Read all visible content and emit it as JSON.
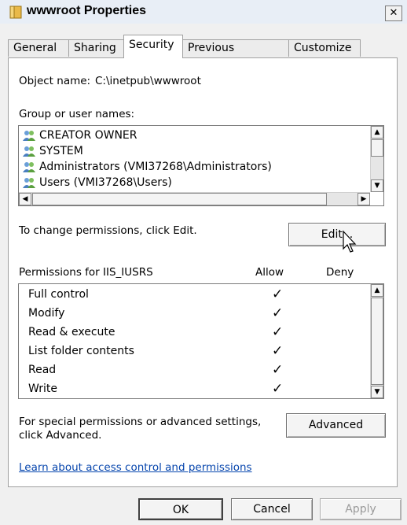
{
  "window": {
    "title": "wwwroot Properties",
    "close_glyph": "✕"
  },
  "tabs": [
    {
      "label": "General"
    },
    {
      "label": "Sharing"
    },
    {
      "label": "Security"
    },
    {
      "label": "Previous Versions"
    },
    {
      "label": "Customize"
    }
  ],
  "security": {
    "object_name_label": "Object name:",
    "object_name_value": "C:\\inetpub\\wwwroot",
    "group_label": "Group or user names:",
    "users": [
      {
        "name": "CREATOR OWNER",
        "icon": "users-icon"
      },
      {
        "name": "SYSTEM",
        "icon": "users-icon"
      },
      {
        "name": "Administrators (VMI37268\\Administrators)",
        "icon": "users-icon"
      },
      {
        "name": "Users (VMI37268\\Users)",
        "icon": "users-icon"
      }
    ],
    "change_text": "To change permissions, click Edit.",
    "edit_label": "Edit...",
    "permissions_label": "Permissions for IIS_IUSRS",
    "allow_header": "Allow",
    "deny_header": "Deny",
    "permissions": [
      {
        "name": "Full control",
        "allow": true,
        "deny": false
      },
      {
        "name": "Modify",
        "allow": true,
        "deny": false
      },
      {
        "name": "Read & execute",
        "allow": true,
        "deny": false
      },
      {
        "name": "List folder contents",
        "allow": true,
        "deny": false
      },
      {
        "name": "Read",
        "allow": true,
        "deny": false
      },
      {
        "name": "Write",
        "allow": true,
        "deny": false
      }
    ],
    "check_glyph": "✓",
    "special_text_line1": "For special permissions or advanced settings,",
    "special_text_line2": "click Advanced.",
    "advanced_label": "Advanced",
    "learn_link": "Learn about access control and permissions"
  },
  "footer": {
    "ok_label": "OK",
    "cancel_label": "Cancel",
    "apply_label": "Apply"
  }
}
